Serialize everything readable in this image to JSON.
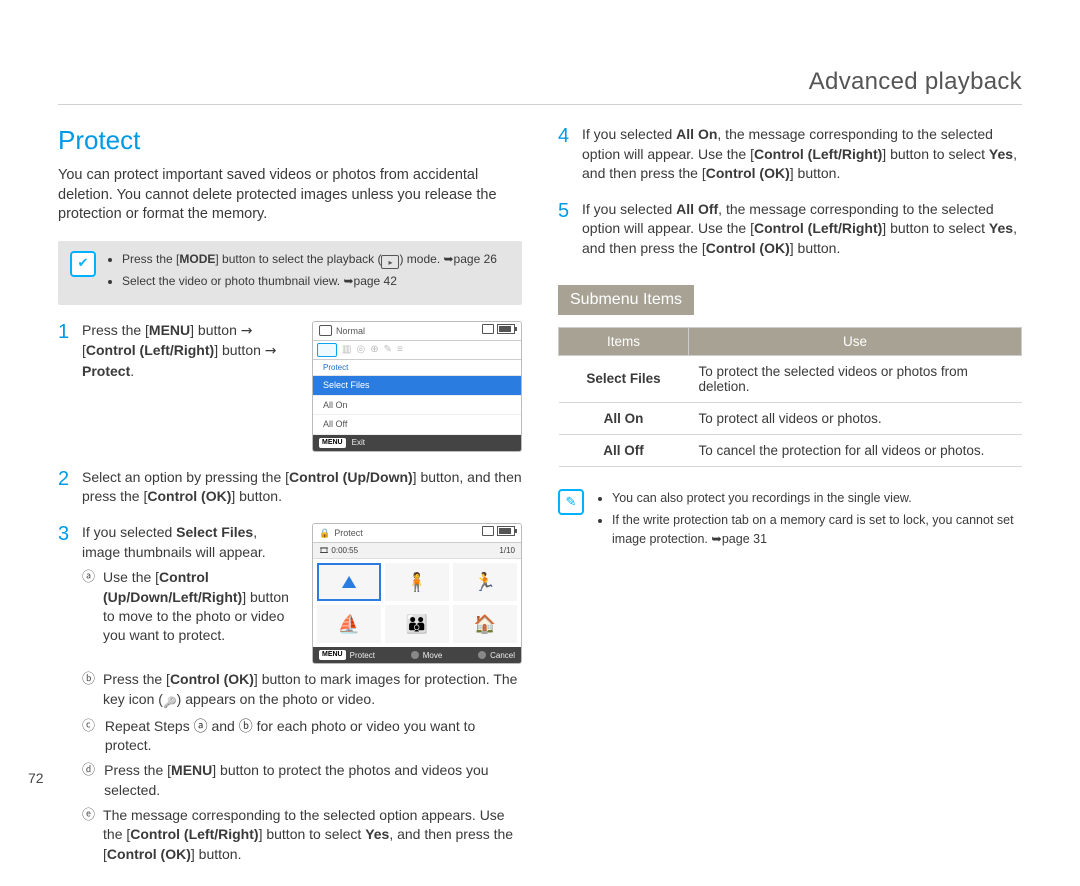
{
  "chapter": "Advanced playback",
  "page_number": "72",
  "section_title": "Protect",
  "intro": "You can protect important saved videos or photos from accidental deletion. You cannot delete protected images unless you release the protection or format the memory.",
  "pre_notes": {
    "n1a": "Press the [",
    "n1b": "MODE",
    "n1c": "] button to select the playback (",
    "n1d": ") mode. ",
    "n1e": "page 26",
    "n2": "Select the video or photo thumbnail view. ",
    "n2b": "page 42"
  },
  "step1": {
    "a": "Press the [",
    "b": "MENU",
    "c": "] button ",
    "d": "[",
    "e": "Control (Left/Right)",
    "f": "] button ",
    "g": "Protect",
    "h": "."
  },
  "step2": {
    "a": "Select an option by pressing the [",
    "b": "Control (Up/Down)",
    "c": "] button, and then press the [",
    "d": "Control (OK)",
    "e": "] button."
  },
  "step3": {
    "a": "If you selected ",
    "b": "Select Files",
    "c": ", image thumbnails will appear."
  },
  "sub": {
    "a": {
      "t1": "Use the [",
      "t2": "Control (Up/Down/Left/Right)",
      "t3": "] button to move to the photo or video you want to protect."
    },
    "b": {
      "t1": "Press the [",
      "t2": "Control (OK)",
      "t3": "] button to mark images for protection. The key icon (",
      "t4": ") appears on the photo or video."
    },
    "c": {
      "t1": "Repeat Steps ",
      "la": "ⓐ",
      "t2": " and ",
      "lb": "ⓑ",
      "t3": " for each photo or video you want to protect."
    },
    "d": {
      "t1": "Press the [",
      "t2": "MENU",
      "t3": "] button to protect the photos and videos you selected."
    },
    "e": {
      "t1": "The message corresponding to the selected option appears. Use the [",
      "t2": "Control (Left/Right)",
      "t3": "] button to select ",
      "t4": "Yes",
      "t5": ", and then press the [",
      "t6": "Control (OK)",
      "t7": "] button."
    }
  },
  "step4": {
    "a": "If you selected ",
    "b": "All On",
    "c": ", the message corresponding to the selected option will appear. Use the [",
    "d": "Control (Left/Right)",
    "e": "] button to select ",
    "f": "Yes",
    "g": ", and then press the [",
    "h": "Control (OK)",
    "i": "] button."
  },
  "step5": {
    "a": "If you selected ",
    "b": "All Off",
    "c": ", the message corresponding to the selected option will appear. Use the [",
    "d": "Control (Left/Right)",
    "e": "] button to select ",
    "f": "Yes",
    "g": ", and then press the [",
    "h": "Control (OK)",
    "i": "] button."
  },
  "submenu_heading": "Submenu Items",
  "table": {
    "h1": "Items",
    "h2": "Use",
    "r1a": "Select Files",
    "r1b": "To protect the selected videos or photos from deletion.",
    "r2a": "All On",
    "r2b": "To protect all videos or photos.",
    "r3a": "All Off",
    "r3b": "To cancel the protection for all videos or photos."
  },
  "info": {
    "n1": "You can also protect you recordings in the single view.",
    "n2a": "If the write protection tab on a memory card is set to lock, you cannot set image protection. ",
    "n2b": "page 31"
  },
  "lcd1": {
    "normal": "Normal",
    "hdr": "Protect",
    "opt1": "Select Files",
    "opt2": "All On",
    "opt3": "All Off",
    "menu": "MENU",
    "exit": "Exit"
  },
  "lcd2": {
    "title": "Protect",
    "time": "0:00:55",
    "count": "1/10",
    "menu": "MENU",
    "f1": "Protect",
    "f2": "Move",
    "f3": "Cancel"
  },
  "labels": {
    "s1": "1",
    "s2": "2",
    "s3": "3",
    "s4": "4",
    "s5": "5",
    "la": "ⓐ",
    "lb": "ⓑ",
    "lc": "ⓒ",
    "ld": "ⓓ",
    "le": "ⓔ"
  },
  "glyphs": {
    "arrow_right": "→",
    "arrow_page": "➥"
  }
}
